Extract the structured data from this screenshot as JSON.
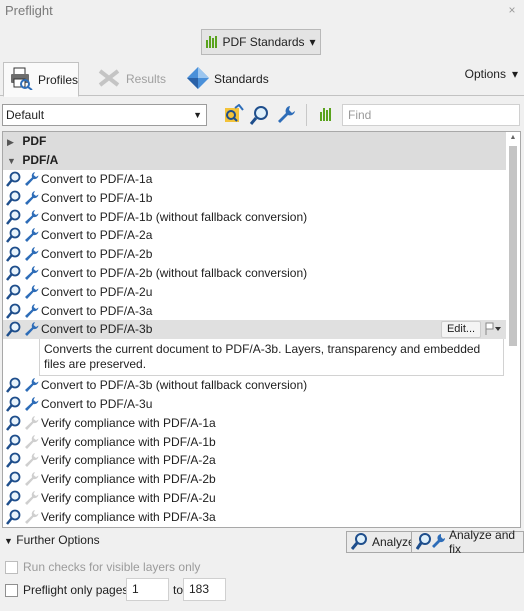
{
  "window": {
    "title": "Preflight",
    "close_glyph": "×"
  },
  "standards_button": {
    "label": "PDF Standards",
    "icon": "bars-icon",
    "caret": "▾"
  },
  "tabs": [
    {
      "label": "Profiles",
      "icon": "printer-icon",
      "active": true
    },
    {
      "label": "Results",
      "icon": "wrench-cross-icon",
      "active": false
    },
    {
      "label": "Standards",
      "icon": "diamond-icon",
      "active": false
    }
  ],
  "options": {
    "label": "Options",
    "caret": "▾"
  },
  "toolbar": {
    "profile_select": "Default",
    "find_placeholder": "Find"
  },
  "groups": [
    {
      "label": "PDF",
      "expanded": false,
      "tri": "▶"
    },
    {
      "label": "PDF/A",
      "expanded": true,
      "tri": "▼"
    }
  ],
  "items": [
    "Convert to PDF/A-1a",
    "Convert to PDF/A-1b",
    "Convert to PDF/A-1b (without fallback conversion)",
    "Convert to PDF/A-2a",
    "Convert to PDF/A-2b",
    "Convert to PDF/A-2b (without fallback conversion)",
    "Convert to PDF/A-2u",
    "Convert to PDF/A-3a",
    "Convert to PDF/A-3b",
    "Convert to PDF/A-3b (without fallback conversion)",
    "Convert to PDF/A-3u",
    "Verify compliance with PDF/A-1a",
    "Verify compliance with PDF/A-1b",
    "Verify compliance with PDF/A-2a",
    "Verify compliance with PDF/A-2b",
    "Verify compliance with PDF/A-2u",
    "Verify compliance with PDF/A-3a"
  ],
  "selected": {
    "edit_label": "Edit...",
    "description": "Converts the current document to PDF/A-3b. Layers, transparency and embedded files are preserved."
  },
  "further_options": {
    "label": "Further Options",
    "tri": "▼"
  },
  "buttons": {
    "analyze": "Analyze",
    "analyze_fix": "Analyze and fix"
  },
  "checks": {
    "visible_layers": "Run checks for visible layers only",
    "preflight_pages": "Preflight only pages"
  },
  "pages": {
    "from": "1",
    "to_label": "to",
    "to": "183"
  },
  "colors": {
    "selected_row": "#e0e0e0",
    "group_row": "#dcdcdc",
    "accent_green": "#5aa31d",
    "accent_blue": "#2e6db8"
  }
}
